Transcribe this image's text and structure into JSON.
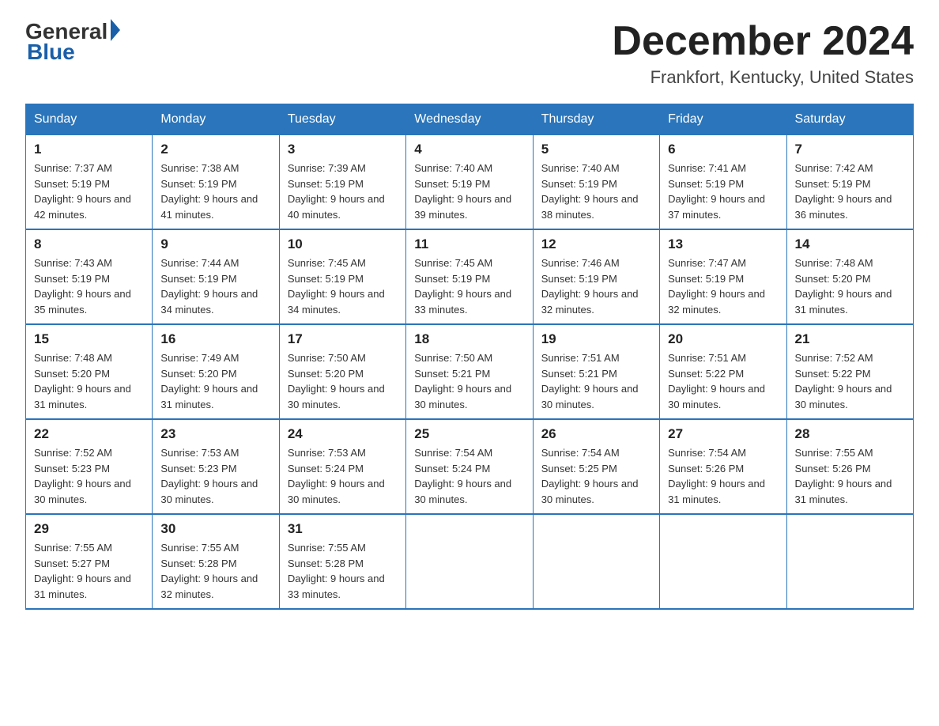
{
  "header": {
    "logo_general": "General",
    "logo_blue": "Blue",
    "month_title": "December 2024",
    "location": "Frankfort, Kentucky, United States"
  },
  "days_of_week": [
    "Sunday",
    "Monday",
    "Tuesday",
    "Wednesday",
    "Thursday",
    "Friday",
    "Saturday"
  ],
  "weeks": [
    [
      {
        "day": "1",
        "sunrise": "7:37 AM",
        "sunset": "5:19 PM",
        "daylight": "9 hours and 42 minutes."
      },
      {
        "day": "2",
        "sunrise": "7:38 AM",
        "sunset": "5:19 PM",
        "daylight": "9 hours and 41 minutes."
      },
      {
        "day": "3",
        "sunrise": "7:39 AM",
        "sunset": "5:19 PM",
        "daylight": "9 hours and 40 minutes."
      },
      {
        "day": "4",
        "sunrise": "7:40 AM",
        "sunset": "5:19 PM",
        "daylight": "9 hours and 39 minutes."
      },
      {
        "day": "5",
        "sunrise": "7:40 AM",
        "sunset": "5:19 PM",
        "daylight": "9 hours and 38 minutes."
      },
      {
        "day": "6",
        "sunrise": "7:41 AM",
        "sunset": "5:19 PM",
        "daylight": "9 hours and 37 minutes."
      },
      {
        "day": "7",
        "sunrise": "7:42 AM",
        "sunset": "5:19 PM",
        "daylight": "9 hours and 36 minutes."
      }
    ],
    [
      {
        "day": "8",
        "sunrise": "7:43 AM",
        "sunset": "5:19 PM",
        "daylight": "9 hours and 35 minutes."
      },
      {
        "day": "9",
        "sunrise": "7:44 AM",
        "sunset": "5:19 PM",
        "daylight": "9 hours and 34 minutes."
      },
      {
        "day": "10",
        "sunrise": "7:45 AM",
        "sunset": "5:19 PM",
        "daylight": "9 hours and 34 minutes."
      },
      {
        "day": "11",
        "sunrise": "7:45 AM",
        "sunset": "5:19 PM",
        "daylight": "9 hours and 33 minutes."
      },
      {
        "day": "12",
        "sunrise": "7:46 AM",
        "sunset": "5:19 PM",
        "daylight": "9 hours and 32 minutes."
      },
      {
        "day": "13",
        "sunrise": "7:47 AM",
        "sunset": "5:19 PM",
        "daylight": "9 hours and 32 minutes."
      },
      {
        "day": "14",
        "sunrise": "7:48 AM",
        "sunset": "5:20 PM",
        "daylight": "9 hours and 31 minutes."
      }
    ],
    [
      {
        "day": "15",
        "sunrise": "7:48 AM",
        "sunset": "5:20 PM",
        "daylight": "9 hours and 31 minutes."
      },
      {
        "day": "16",
        "sunrise": "7:49 AM",
        "sunset": "5:20 PM",
        "daylight": "9 hours and 31 minutes."
      },
      {
        "day": "17",
        "sunrise": "7:50 AM",
        "sunset": "5:20 PM",
        "daylight": "9 hours and 30 minutes."
      },
      {
        "day": "18",
        "sunrise": "7:50 AM",
        "sunset": "5:21 PM",
        "daylight": "9 hours and 30 minutes."
      },
      {
        "day": "19",
        "sunrise": "7:51 AM",
        "sunset": "5:21 PM",
        "daylight": "9 hours and 30 minutes."
      },
      {
        "day": "20",
        "sunrise": "7:51 AM",
        "sunset": "5:22 PM",
        "daylight": "9 hours and 30 minutes."
      },
      {
        "day": "21",
        "sunrise": "7:52 AM",
        "sunset": "5:22 PM",
        "daylight": "9 hours and 30 minutes."
      }
    ],
    [
      {
        "day": "22",
        "sunrise": "7:52 AM",
        "sunset": "5:23 PM",
        "daylight": "9 hours and 30 minutes."
      },
      {
        "day": "23",
        "sunrise": "7:53 AM",
        "sunset": "5:23 PM",
        "daylight": "9 hours and 30 minutes."
      },
      {
        "day": "24",
        "sunrise": "7:53 AM",
        "sunset": "5:24 PM",
        "daylight": "9 hours and 30 minutes."
      },
      {
        "day": "25",
        "sunrise": "7:54 AM",
        "sunset": "5:24 PM",
        "daylight": "9 hours and 30 minutes."
      },
      {
        "day": "26",
        "sunrise": "7:54 AM",
        "sunset": "5:25 PM",
        "daylight": "9 hours and 30 minutes."
      },
      {
        "day": "27",
        "sunrise": "7:54 AM",
        "sunset": "5:26 PM",
        "daylight": "9 hours and 31 minutes."
      },
      {
        "day": "28",
        "sunrise": "7:55 AM",
        "sunset": "5:26 PM",
        "daylight": "9 hours and 31 minutes."
      }
    ],
    [
      {
        "day": "29",
        "sunrise": "7:55 AM",
        "sunset": "5:27 PM",
        "daylight": "9 hours and 31 minutes."
      },
      {
        "day": "30",
        "sunrise": "7:55 AM",
        "sunset": "5:28 PM",
        "daylight": "9 hours and 32 minutes."
      },
      {
        "day": "31",
        "sunrise": "7:55 AM",
        "sunset": "5:28 PM",
        "daylight": "9 hours and 33 minutes."
      },
      null,
      null,
      null,
      null
    ]
  ]
}
